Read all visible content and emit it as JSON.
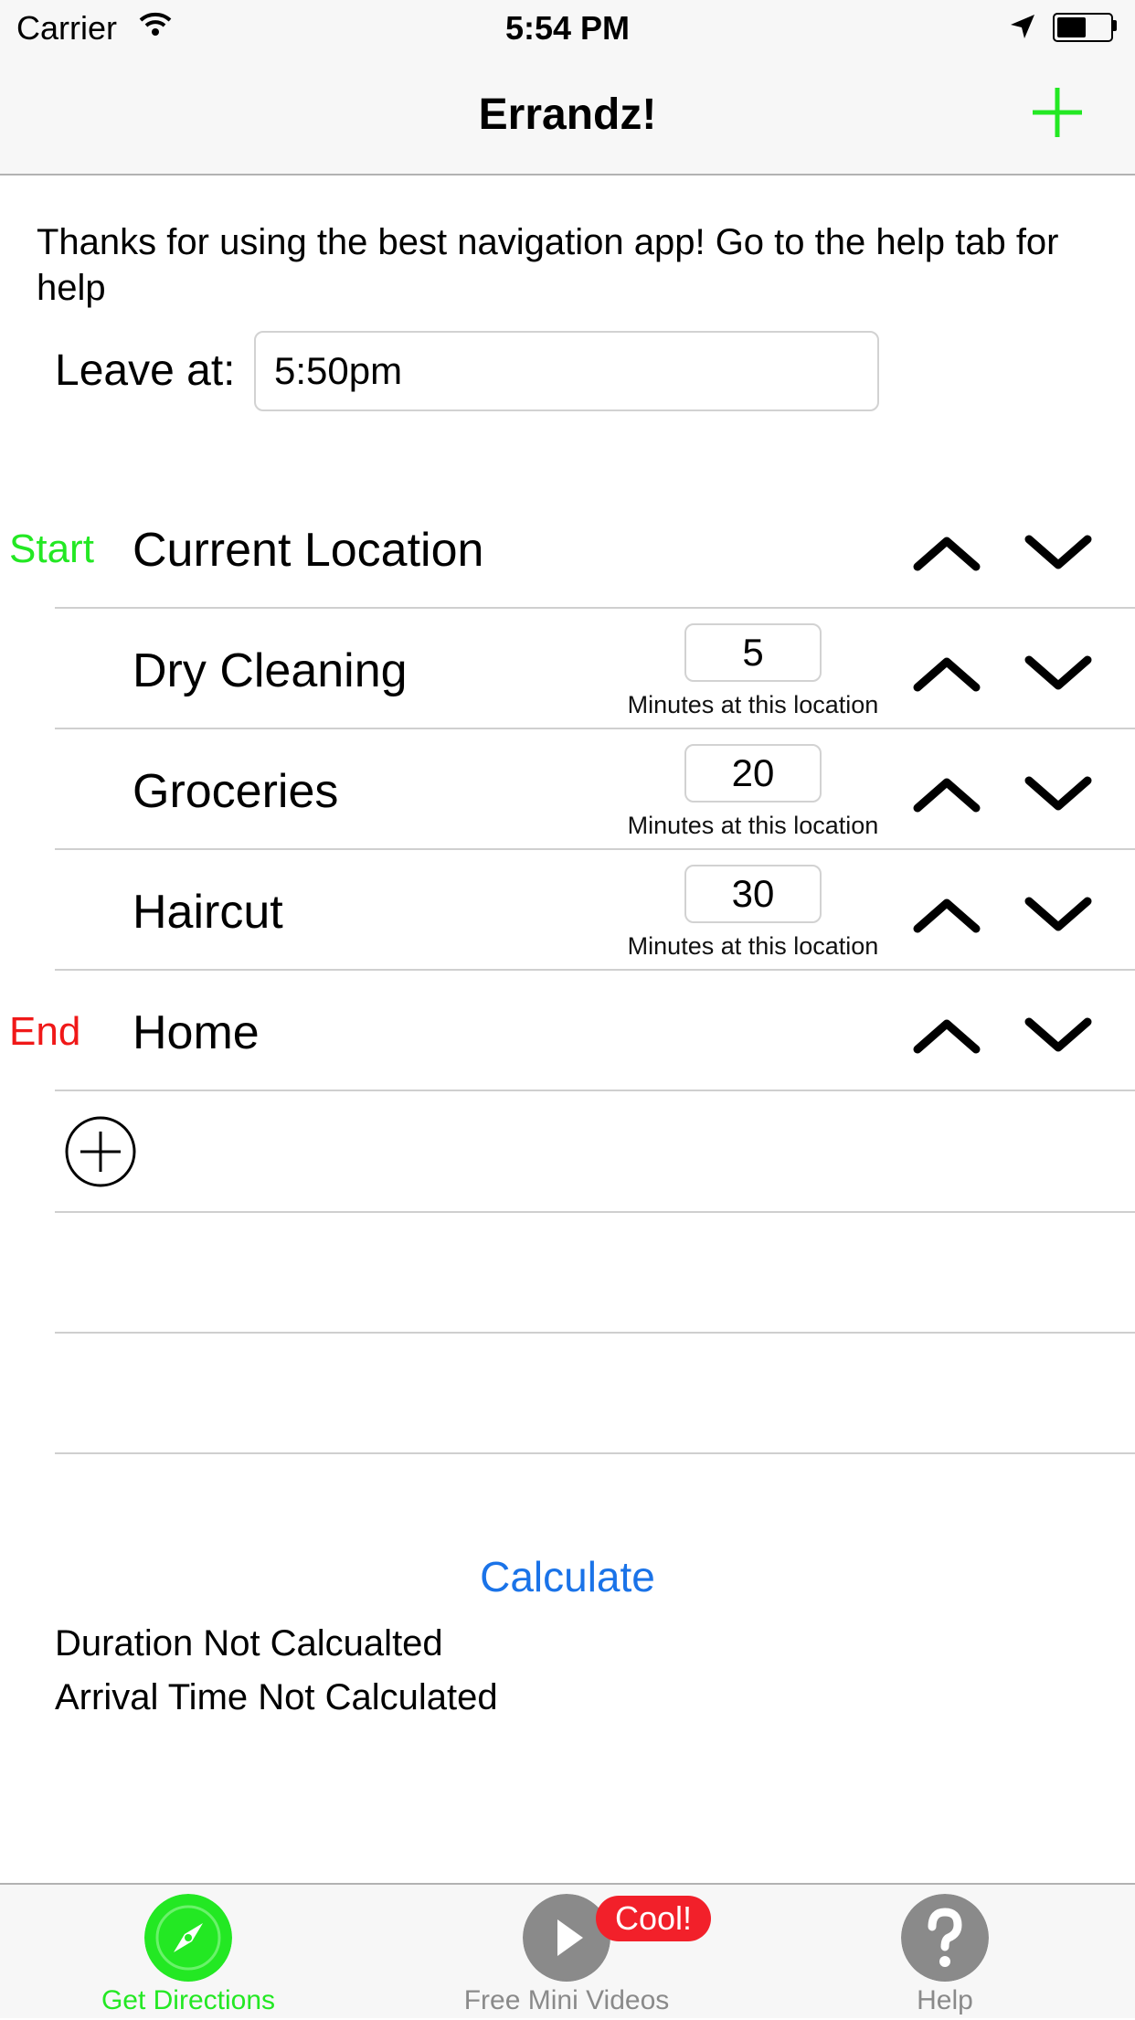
{
  "status_bar": {
    "carrier": "Carrier",
    "time": "5:54 PM",
    "battery_level": 0.6
  },
  "navbar": {
    "title": "Errandz!",
    "add_icon": "plus-icon",
    "accent_color": "#23e823"
  },
  "intro_text": "Thanks for using the best navigation app! Go to the help tab for help",
  "leave": {
    "label": "Leave at:",
    "value": "5:50pm"
  },
  "stops": [
    {
      "tag": "Start",
      "tag_color": "#23e823",
      "name": "Current Location"
    },
    {
      "tag": "",
      "name": "Dry Cleaning",
      "minutes": "5",
      "caption": "Minutes at this location"
    },
    {
      "tag": "",
      "name": "Groceries",
      "minutes": "20",
      "caption": "Minutes at this location"
    },
    {
      "tag": "",
      "name": "Haircut",
      "minutes": "30",
      "caption": "Minutes at this location"
    },
    {
      "tag": "End",
      "tag_color": "#f01818",
      "name": "Home"
    }
  ],
  "calculate_label": "Calculate",
  "results": {
    "duration": "Duration Not Calcualted",
    "arrival": "Arrival Time Not Calculated"
  },
  "tabs": [
    {
      "label": "Get Directions",
      "icon": "compass-icon",
      "color": "#23e823",
      "selected": true
    },
    {
      "label": "Free Mini Videos",
      "icon": "play-icon",
      "color": "#8a8a8a",
      "selected": false,
      "badge": "Cool!"
    },
    {
      "label": "Help",
      "icon": "question-icon",
      "color": "#8a8a8a",
      "selected": false
    }
  ]
}
